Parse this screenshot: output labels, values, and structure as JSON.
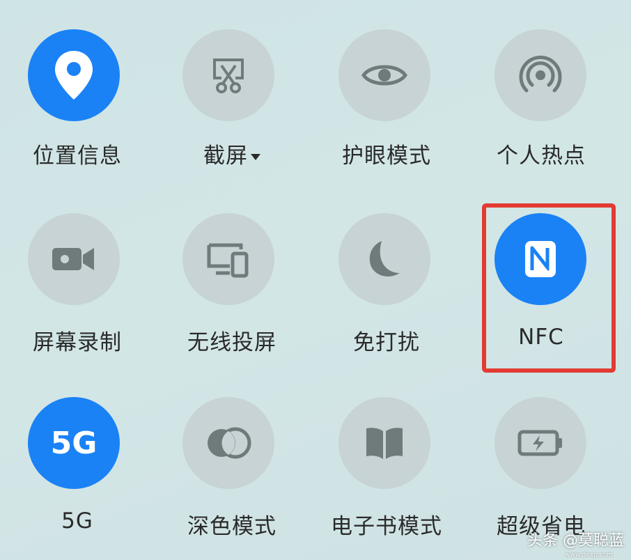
{
  "tiles": [
    {
      "label": "位置信息",
      "active": true,
      "icon": "location-pin-icon"
    },
    {
      "label": "截屏",
      "active": false,
      "icon": "screenshot-scissors-icon",
      "has_dropdown": true
    },
    {
      "label": "护眼模式",
      "active": false,
      "icon": "eye-icon"
    },
    {
      "label": "个人热点",
      "active": false,
      "icon": "hotspot-icon"
    },
    {
      "label": "屏幕录制",
      "active": false,
      "icon": "video-camera-icon"
    },
    {
      "label": "无线投屏",
      "active": false,
      "icon": "screen-cast-icon"
    },
    {
      "label": "免打扰",
      "active": false,
      "icon": "moon-icon"
    },
    {
      "label": "NFC",
      "active": true,
      "icon": "nfc-icon",
      "highlighted": true
    },
    {
      "label": "5G",
      "active": true,
      "icon": "5g-icon",
      "icon_text": "5G"
    },
    {
      "label": "深色模式",
      "active": false,
      "icon": "dark-mode-icon"
    },
    {
      "label": "电子书模式",
      "active": false,
      "icon": "book-icon"
    },
    {
      "label": "超级省电",
      "active": false,
      "icon": "battery-saver-icon"
    }
  ],
  "watermark": {
    "text": "头条 @莫聪蓝",
    "sub": "www.dnxp.com"
  },
  "colors": {
    "active": "#1a82f5",
    "inactive": "#c7d3d4",
    "icon_inactive": "#6f7a7b",
    "highlight": "#e23b33"
  }
}
